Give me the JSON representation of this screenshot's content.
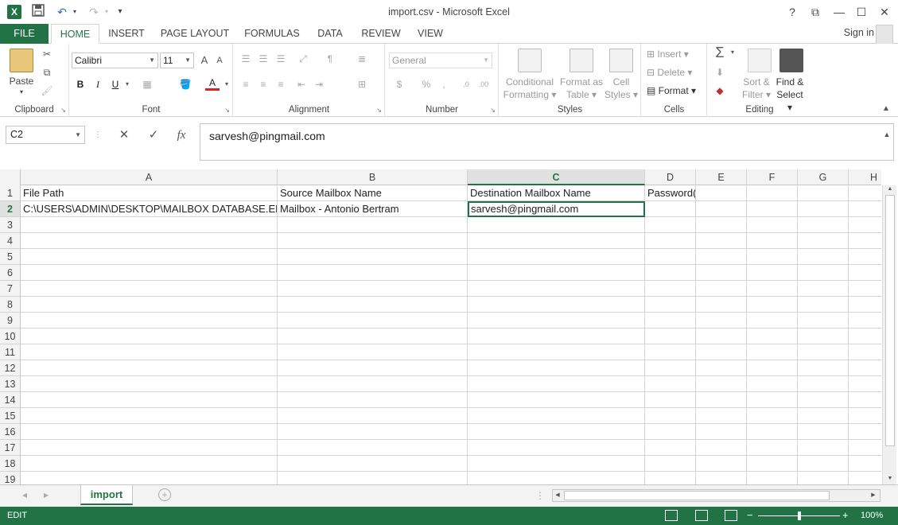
{
  "window": {
    "title": "import.csv - Microsoft Excel",
    "help": "?",
    "restore_ribbon": "⧉",
    "minimize": "—",
    "maximize": "☐",
    "close": "✕"
  },
  "qat": {
    "app_letter": "X",
    "save": "💾",
    "undo": "↶",
    "redo": "↷",
    "customize": "▾"
  },
  "tabs": {
    "file": "FILE",
    "items": [
      "HOME",
      "INSERT",
      "PAGE LAYOUT",
      "FORMULAS",
      "DATA",
      "REVIEW",
      "VIEW"
    ],
    "active": "HOME",
    "signin": "Sign in"
  },
  "ribbon": {
    "clipboard": {
      "label": "Clipboard",
      "paste": "Paste"
    },
    "font": {
      "label": "Font",
      "name": "Calibri",
      "size": "11",
      "bold": "B",
      "italic": "I",
      "underline": "U",
      "grow": "A",
      "shrink": "A",
      "fontcolor": "A"
    },
    "alignment": {
      "label": "Alignment"
    },
    "number": {
      "label": "Number",
      "format": "General",
      "currency": "$",
      "percent": "%",
      "comma": ","
    },
    "styles": {
      "label": "Styles",
      "conditional": [
        "Conditional",
        "Formatting"
      ],
      "format_as": [
        "Format as",
        "Table"
      ],
      "cell_styles": [
        "Cell",
        "Styles"
      ]
    },
    "cells": {
      "label": "Cells",
      "insert": "Insert",
      "delete": "Delete",
      "format": "Format"
    },
    "editing": {
      "label": "Editing",
      "sort": [
        "Sort &",
        "Filter"
      ],
      "find": [
        "Find &",
        "Select"
      ]
    }
  },
  "formula_bar": {
    "name_box": "C2",
    "cancel": "✕",
    "enter": "✓",
    "fx": "fx",
    "content": "sarvesh@pingmail.com"
  },
  "columns": [
    "A",
    "B",
    "C",
    "D",
    "E",
    "F",
    "G",
    "H"
  ],
  "selected_column": "C",
  "rows": [
    "1",
    "2",
    "3",
    "4",
    "5",
    "6",
    "7",
    "8",
    "9",
    "10",
    "11",
    "12",
    "13",
    "14",
    "15",
    "16",
    "17",
    "18",
    "19"
  ],
  "selected_row": "2",
  "cells": {
    "A1": "File Path",
    "B1": "Source Mailbox Name",
    "C1": "Destination Mailbox Name",
    "D1": "Password(Optional)",
    "A2": "C:\\USERS\\ADMIN\\DESKTOP\\MAILBOX DATABASE.EDB",
    "B2": "Mailbox - Antonio Bertram",
    "C2": "sarvesh@pingmail.com"
  },
  "sheet": {
    "name": "import",
    "add": "+",
    "prev": "◀",
    "next": "▶"
  },
  "status": {
    "mode": "EDIT",
    "zoom": "100%",
    "zoom_out": "−",
    "zoom_in": "+"
  },
  "colors": {
    "accent": "#217346"
  }
}
